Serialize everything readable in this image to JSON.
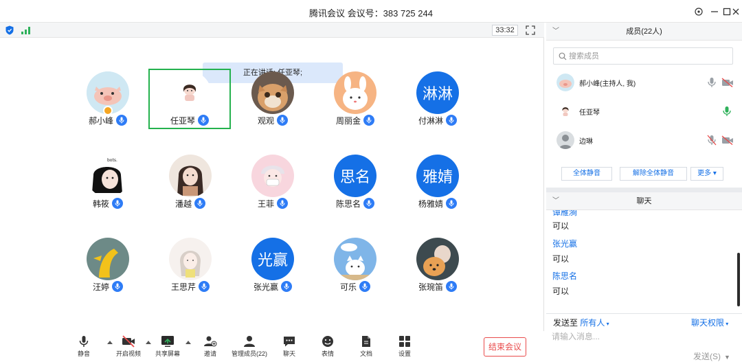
{
  "window": {
    "title": "腾讯会议 会议号：383 725 244",
    "timer": "33:32"
  },
  "speaking": {
    "prefix": "正在讲话: ",
    "name": "任亚琴;"
  },
  "tiles": [
    {
      "name": "郝小峰",
      "avatar_text": "",
      "avatar": "pig-icon",
      "host": true,
      "selected": false
    },
    {
      "name": "任亚琴",
      "avatar_text": "",
      "avatar": "girl-icon",
      "host": false,
      "selected": true
    },
    {
      "name": "观观",
      "avatar_text": "",
      "avatar": "cat-icon",
      "host": false,
      "selected": false
    },
    {
      "name": "周丽金",
      "avatar_text": "",
      "avatar": "bunny-icon",
      "host": false,
      "selected": false
    },
    {
      "name": "付淋淋",
      "avatar_text": "淋淋",
      "avatar": "text",
      "host": false,
      "selected": false
    },
    {
      "name": "韩筱",
      "avatar_text": "",
      "avatar": "anime-girl-icon",
      "host": false,
      "selected": false
    },
    {
      "name": "潘越",
      "avatar_text": "",
      "avatar": "painted-girl-icon",
      "host": false,
      "selected": false
    },
    {
      "name": "王菲",
      "avatar_text": "",
      "avatar": "masked-girl-icon",
      "host": false,
      "selected": false
    },
    {
      "name": "陈思名",
      "avatar_text": "思名",
      "avatar": "text",
      "host": false,
      "selected": false
    },
    {
      "name": "杨雅婧",
      "avatar_text": "雅婧",
      "avatar": "text",
      "host": false,
      "selected": false
    },
    {
      "name": "汪婷",
      "avatar_text": "",
      "avatar": "yellow-character-icon",
      "host": false,
      "selected": false
    },
    {
      "name": "王思芹",
      "avatar_text": "",
      "avatar": "sketch-girl-icon",
      "host": false,
      "selected": false
    },
    {
      "name": "张光赢",
      "avatar_text": "光赢",
      "avatar": "text",
      "host": false,
      "selected": false
    },
    {
      "name": "可乐",
      "avatar_text": "",
      "avatar": "sky-cat-icon",
      "host": false,
      "selected": false
    },
    {
      "name": "张琬笛",
      "avatar_text": "",
      "avatar": "dog-icon",
      "host": false,
      "selected": false
    }
  ],
  "toolbar": {
    "mute": "静音",
    "video": "开启视频",
    "share": "共享屏幕",
    "invite": "邀请",
    "members": "管理成员(22)",
    "chat": "聊天",
    "emoji": "表情",
    "docs": "文档",
    "settings": "设置",
    "end": "结束会议"
  },
  "members_panel": {
    "title": "成员(22人)",
    "search_placeholder": "搜索成员",
    "members": [
      {
        "name": "郝小峰(主持人, 我)",
        "mic": "muted",
        "cam": "off"
      },
      {
        "name": "任亚琴",
        "mic": "active",
        "cam": "none"
      },
      {
        "name": "边琳",
        "mic": "muted",
        "cam": "off"
      }
    ],
    "mute_all": "全体静音",
    "unmute_all": "解除全体静音",
    "more": "更多 ▾"
  },
  "chat": {
    "title": "聊天",
    "messages": [
      {
        "sender": "谭雁漪",
        "text": "可以"
      },
      {
        "sender": "张光赢",
        "text": "可以"
      },
      {
        "sender": "陈思名",
        "text": "可以"
      }
    ],
    "send_to_label": "发送至",
    "send_to_value": "所有人",
    "permission": "聊天权限",
    "input_placeholder": "请输入消息...",
    "send": "发送(S)"
  },
  "colors": {
    "accent": "#1570e6",
    "speaking_bg": "#dbe8fb",
    "selected_border": "#23b14d",
    "end_red": "#e94a4a"
  }
}
